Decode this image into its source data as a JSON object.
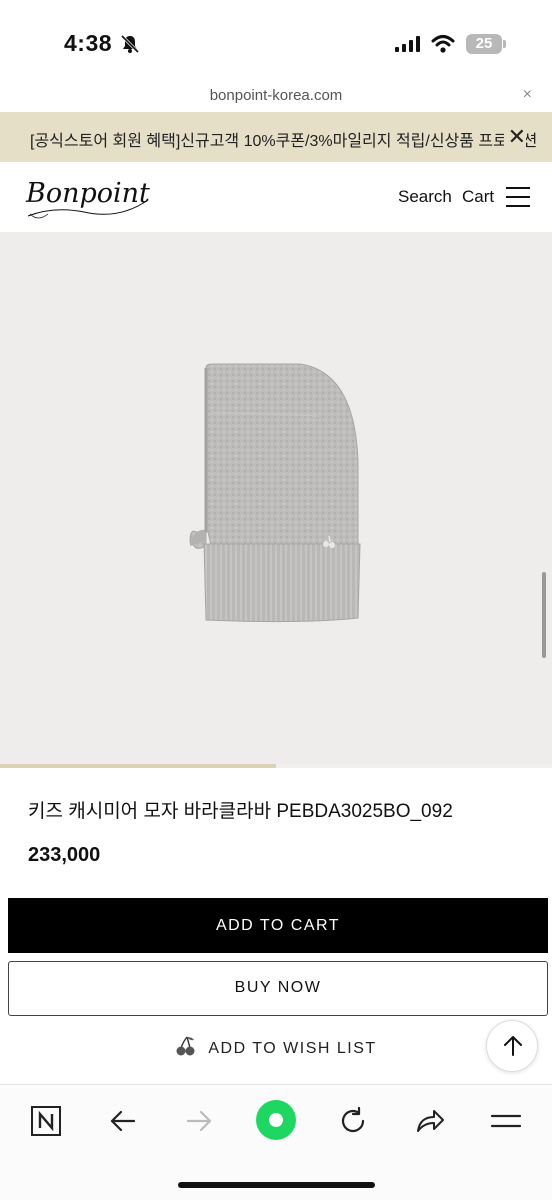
{
  "status_bar": {
    "time": "4:38",
    "battery_level": "25",
    "icons": [
      "bell-slash-icon",
      "signal-icon",
      "wifi-icon",
      "battery-icon"
    ]
  },
  "url_bar": {
    "url": "bonpoint-korea.com",
    "close_label": "×"
  },
  "promo_banner": {
    "text": "[공식스토어 회원 혜택]신규고객 10%쿠폰/3%마일리지 적립/신상품 프로모션",
    "close_label": "✕"
  },
  "header": {
    "logo_text": "Bonpoint",
    "search_label": "Search",
    "cart_label": "Cart",
    "menu_icon": "hamburger-menu-icon"
  },
  "product": {
    "image_alt_icon": "balaclava-product-image",
    "gallery_progress": 0.5,
    "title": "키즈 캐시미어 모자 바라클라바 PEBDA3025BO_092",
    "price": "233,000"
  },
  "actions": {
    "add_to_cart": "ADD TO CART",
    "buy_now": "BUY NOW",
    "wishlist": "ADD TO WISH LIST",
    "wishlist_icon": "cherry-icon",
    "scroll_top_icon": "arrow-up-icon"
  },
  "browser_toolbar": {
    "items": [
      "naver-icon",
      "back-arrow-icon",
      "forward-arrow-icon",
      "green-dot-icon",
      "reload-icon",
      "share-icon",
      "menu-lines-icon"
    ]
  },
  "colors": {
    "promo_bg": "#e5dfc8",
    "image_bg": "#efedeb",
    "primary_button": "#000000",
    "accent_green": "#1ed760"
  }
}
